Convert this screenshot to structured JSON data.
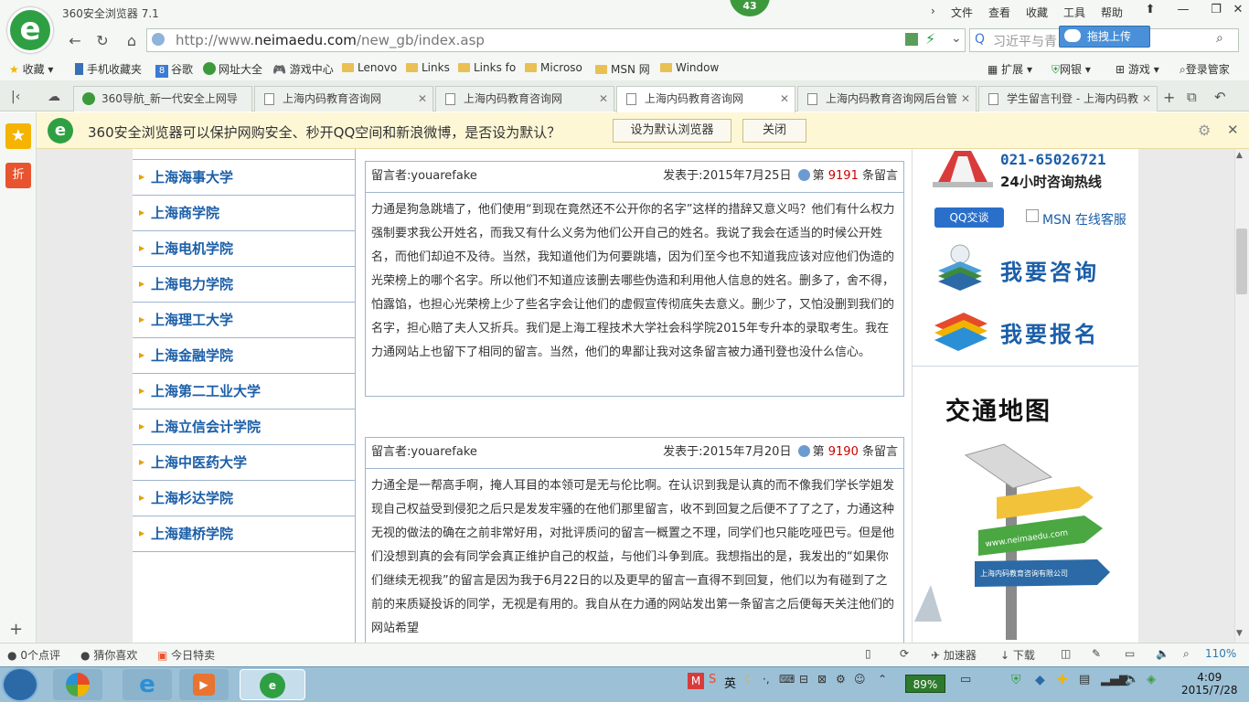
{
  "app": {
    "title": "360安全浏览器 7.1",
    "badge": "43",
    "menu": [
      "文件",
      "查看",
      "收藏",
      "工具",
      "帮助"
    ],
    "window_controls": [
      "minimize",
      "maximize",
      "close"
    ]
  },
  "address_bar": {
    "url_prefix": "http://www.",
    "url_domain": "neimaedu.com",
    "url_path": "/new_gb/index.asp",
    "search_text": "习近平与青",
    "upload_label": "拖拽上传"
  },
  "bookmarks": [
    "收藏",
    "手机收藏夹",
    "谷歌",
    "网址大全",
    "游戏中心",
    "Lenovo",
    "Links",
    "Links fo",
    "Microso",
    "MSN 网",
    "Window"
  ],
  "bookmarks_right": [
    "扩展",
    "网银",
    "游戏",
    "登录管家"
  ],
  "tabs": [
    {
      "label": "360导航_新一代安全上网导",
      "active": false
    },
    {
      "label": "上海内码教育咨询网",
      "active": false
    },
    {
      "label": "上海内码教育咨询网",
      "active": false
    },
    {
      "label": "上海内码教育咨询网",
      "active": true
    },
    {
      "label": "上海内码教育咨询网后台管",
      "active": false
    },
    {
      "label": "学生留言刊登 - 上海内码教",
      "active": false
    }
  ],
  "infobar": {
    "text": "360安全浏览器可以保护网购安全、秒开QQ空间和新浪微博，是否设为默认？",
    "set_default": "设为默认浏览器",
    "close": "关闭"
  },
  "sidebar": {
    "star_icon": "★",
    "discount_label": "折"
  },
  "universities": [
    "上海海事大学",
    "上海商学院",
    "上海电机学院",
    "上海电力学院",
    "上海理工大学",
    "上海金融学院",
    "上海第二工业大学",
    "上海立信会计学院",
    "上海中医药大学",
    "上海杉达学院",
    "上海建桥学院"
  ],
  "messages": [
    {
      "author_label": "留言者:",
      "author": "youarefake",
      "date_label": "发表于:2015年7月25日",
      "num_prefix": "第",
      "num": "9191",
      "num_suffix": "条留言",
      "body": "力通是狗急跳墙了，他们使用“到现在竟然还不公开你的名字”这样的措辞又意义吗？他们有什么权力强制要求我公开姓名，而我又有什么义务为他们公开自己的姓名。我说了我会在适当的时候公开姓名，而他们却迫不及待。当然，我知道他们为何要跳墙，因为们至今也不知道我应该对应他们伪造的光荣榜上的哪个名字。所以他们不知道应该删去哪些伪造和利用他人信息的姓名。删多了，舍不得，怕露馅，也担心光荣榜上少了些名字会让他们的虚假宣传彻底失去意义。删少了，又怕没删到我们的名字，担心赔了夫人又折兵。我们是上海工程技术大学社会科学院2015年专升本的录取考生。我在力通网站上也留下了相同的留言。当然，他们的卑鄙让我对这条留言被力通刊登也没什么信心。"
    },
    {
      "author_label": "留言者:",
      "author": "youarefake",
      "date_label": "发表于:2015年7月20日",
      "num_prefix": "第",
      "num": "9190",
      "num_suffix": "条留言",
      "body": "力通全是一帮高手啊，掩人耳目的本领可是无与伦比啊。在认识到我是认真的而不像我们学长学姐发现自己权益受到侵犯之后只是发发牢骚的在他们那里留言，收不到回复之后便不了了之了，力通这种无视的做法的确在之前非常好用，对批评质问的留言一概置之不理，同学们也只能吃哑巴亏。但是他们没想到真的会有同学会真正维护自己的权益，与他们斗争到底。我想指出的是，我发出的“如果你们继续无视我”的留言是因为我于6月22日的以及更早的留言一直得不到回复，他们以为有碰到了之前的来质疑投诉的同学，无视是有用的。我自从在力通的网站发出第一条留言之后便每天关注他们的网站希望"
    }
  ],
  "right": {
    "hotline_num": "021-65026721",
    "hotline_label": "24小时咨询热线",
    "qq_label": "QQ交谈",
    "msn_label": "MSN 在线客服",
    "consult": "我要咨询",
    "signup": "我要报名",
    "map_title": "交通地图",
    "sign_url": "www.neimaedu.com",
    "sign_company": "上海内码教育咨询有限公司"
  },
  "statusbar": {
    "left": [
      "0个点评",
      "猜你喜欢",
      "今日特卖"
    ],
    "right": [
      "加速器",
      "下载"
    ],
    "zoom": "110%"
  },
  "taskbar": {
    "battery": "89%",
    "ime": "英",
    "time": "4:09",
    "date": "2015/7/28"
  },
  "colors": {
    "accent_green": "#2ea043",
    "link_blue": "#1b5ea8",
    "number_red": "#cc0000"
  }
}
